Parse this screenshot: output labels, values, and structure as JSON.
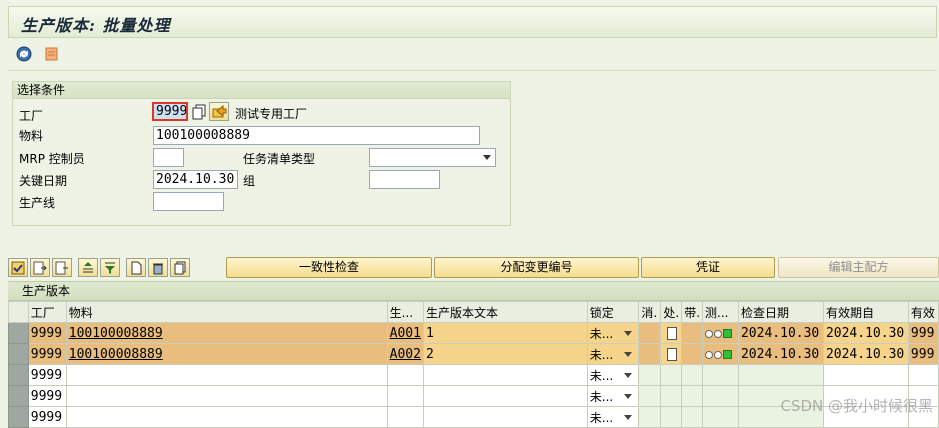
{
  "window": {
    "title": "生产版本: 批量处理"
  },
  "appbar": {
    "icons": [
      "execute-icon",
      "other-icon"
    ]
  },
  "selection": {
    "title": "选择条件",
    "plant_label": "工厂",
    "plant_value": "9999",
    "plant_desc": "测试专用工厂",
    "material_label": "物料",
    "material_value": "100100008889",
    "mrp_label": "MRP 控制员",
    "mrp_value": "",
    "tasklist_label": "任务清单类型",
    "tasklist_value": "",
    "keydate_label": "关键日期",
    "keydate_value": "2024.10.30",
    "group_label": "组",
    "group_value": "",
    "prodline_label": "生产线",
    "prodline_value": ""
  },
  "grid_toolbar": {
    "consistency_label": "一致性检查",
    "assign_change_label": "分配变更编号",
    "voucher_label": "凭证",
    "edit_master_label": "编辑主配方"
  },
  "grid": {
    "title": "生产版本",
    "columns": [
      "工厂",
      "物料",
      "生...",
      "生产版本文本",
      "锁定",
      "消.",
      "处.",
      "带.",
      "测...",
      "检查日期",
      "有效期自",
      "有效"
    ],
    "rows": [
      {
        "plant": "9999",
        "material": "100100008889",
        "version": "A001",
        "text": "1",
        "lock": "未...",
        "check_date": "2024.10.30",
        "valid_from": "2024.10.30",
        "valid_to": "999"
      },
      {
        "plant": "9999",
        "material": "100100008889",
        "version": "A002",
        "text": "2",
        "lock": "未...",
        "check_date": "2024.10.30",
        "valid_from": "2024.10.30",
        "valid_to": "999"
      },
      {
        "plant": "9999",
        "lock": "未..."
      },
      {
        "plant": "9999",
        "lock": "未..."
      },
      {
        "plant": "9999",
        "lock": "未..."
      }
    ]
  },
  "watermark": "CSDN @我小时候很黑",
  "colors": {
    "highlight_row": "#e8bd7d",
    "highlight_light": "#f6d48b",
    "background": "#eef3e6"
  }
}
